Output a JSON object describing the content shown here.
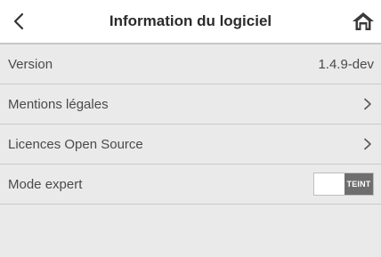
{
  "header": {
    "title": "Information du logiciel",
    "back_icon": "chevron-left-icon",
    "home_icon": "home-icon"
  },
  "rows": [
    {
      "label": "Version",
      "value": "1.4.9-dev"
    },
    {
      "label": "Mentions légales",
      "icon": "chevron-right-icon"
    },
    {
      "label": "Licences Open Source",
      "icon": "chevron-right-icon"
    },
    {
      "label": "Mode expert",
      "toggle_state": "TEINT"
    }
  ],
  "colors": {
    "background": "#eaeaea",
    "header_bg": "#ffffff",
    "text": "#4a4a4a",
    "toggle_off": "#6e6e6e"
  }
}
